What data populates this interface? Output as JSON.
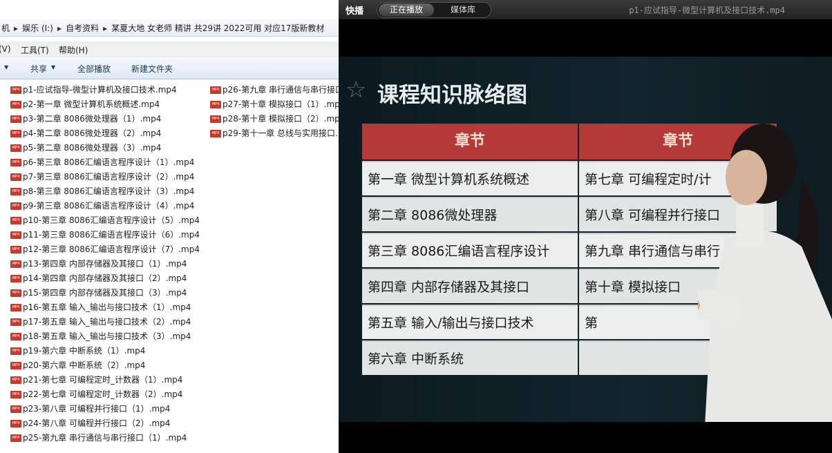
{
  "explorer": {
    "breadcrumb": [
      "机",
      "娱乐 (I:)",
      "自考资料",
      "某夏大地 女老师 精讲 共29讲 2022可用 对应17版新教材"
    ],
    "menu": [
      "(V)",
      "工具(T)",
      "帮助(H)"
    ],
    "toolbar": {
      "share": "共享",
      "play_all": "全部播放",
      "new_folder": "新建文件夹"
    },
    "file_icon_text": "MP4",
    "files_col1": [
      "p1-应试指导-微型计算机及接口技术.mp4",
      "p2-第一章 微型计算机系统概述.mp4",
      "p3-第二章 8086微处理器（1）.mp4",
      "p4-第二章 8086微处理器（2）.mp4",
      "p5-第二章 8086微处理器（3）.mp4",
      "p6-第三章 8086汇编语言程序设计（1）.mp4",
      "p7-第三章 8086汇编语言程序设计（2）.mp4",
      "p8-第三章 8086汇编语言程序设计（3）.mp4",
      "p9-第三章 8086汇编语言程序设计（4）.mp4",
      "p10-第三章 8086汇编语言程序设计（5）.mp4",
      "p11-第三章 8086汇编语言程序设计（6）.mp4",
      "p12-第三章 8086汇编语言程序设计（7）.mp4",
      "p13-第四章 内部存储器及其接口（1）.mp4",
      "p14-第四章 内部存储器及其接口（2）.mp4",
      "p15-第四章 内部存储器及其接口（3）.mp4",
      "p16-第五章 输入_输出与接口技术（1）.mp4",
      "p17-第五章 输入_输出与接口技术（2）.mp4",
      "p18-第五章 输入_输出与接口技术（3）.mp4",
      "p19-第六章 中断系统（1）.mp4",
      "p20-第六章 中断系统（2）.mp4",
      "p21-第七章 可编程定时_计数器（1）.mp4",
      "p22-第七章 可编程定时_计数器（2）.mp4",
      "p23-第八章 可编程并行接口（1）.mp4",
      "p24-第八章 可编程并行接口（2）.mp4",
      "p25-第九章 串行通信与串行接口（1）.mp4"
    ],
    "files_col2": [
      "p26-第九章 串行通信与串行接口",
      "p27-第十章 模拟接口（1）.mp",
      "p28-第十章 模拟接口（2）.mp",
      "p29-第十一章 总线与实用接口."
    ]
  },
  "player": {
    "app_name": "快播",
    "tabs": [
      "正在播放",
      "媒体库"
    ],
    "now_playing": "p1-应试指导-微型计算机及接口技术.mp4",
    "slide": {
      "title": "课程知识脉络图",
      "headers": [
        "章节",
        "章节"
      ],
      "left_column": [
        "第一章  微型计算机系统概述",
        "第二章   8086微处理器",
        "第三章   8086汇编语言程序设计",
        "第四章   内部存储器及其接口",
        "第五章   输入/输出与接口技术",
        "第六章   中断系统"
      ],
      "right_column": [
        "第七章   可编程定时/计",
        "第八章   可编程并行接口",
        "第九章   串行通信与串行",
        "第十章   模拟接口",
        "第",
        ""
      ]
    }
  }
}
